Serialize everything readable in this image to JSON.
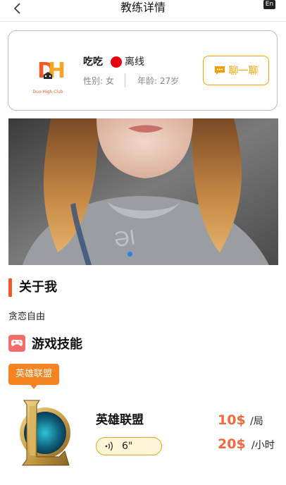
{
  "header": {
    "title": "教练详情",
    "lang_badge": "En"
  },
  "profile": {
    "name": "吃吃",
    "status": "离线",
    "status_color": "#e60012",
    "gender_label": "性别: 女",
    "age_label": "年龄: 27岁",
    "chat_button": "聊一聊",
    "avatar_logo_text": "Duo High Club"
  },
  "photo_carousel": {
    "active_index": 0,
    "dot_color": "#2d7fe0"
  },
  "about": {
    "title": "关于我",
    "text": "贪恋自由"
  },
  "skills": {
    "title": "游戏技能",
    "tag": "英雄联盟",
    "game": {
      "name": "英雄联盟",
      "voice_duration": "6\"",
      "prices": [
        {
          "amount": "10$",
          "unit": "/局"
        },
        {
          "amount": "20$",
          "unit": "/小时"
        }
      ]
    }
  },
  "colors": {
    "accent_orange": "#f05a28",
    "chat_border": "#f0a000",
    "price": "#f26a3b",
    "tag": "#f5831f"
  }
}
